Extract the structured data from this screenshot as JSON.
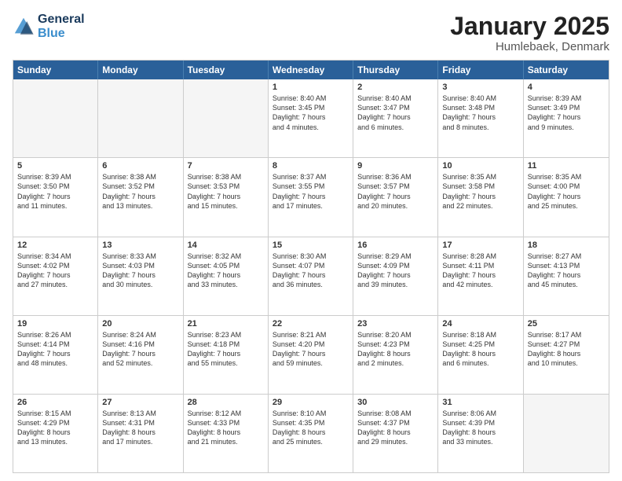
{
  "header": {
    "logo_general": "General",
    "logo_blue": "Blue",
    "month": "January 2025",
    "location": "Humlebaek, Denmark"
  },
  "weekdays": [
    "Sunday",
    "Monday",
    "Tuesday",
    "Wednesday",
    "Thursday",
    "Friday",
    "Saturday"
  ],
  "rows": [
    [
      {
        "day": "",
        "text": "",
        "shaded": true
      },
      {
        "day": "",
        "text": "",
        "shaded": true
      },
      {
        "day": "",
        "text": "",
        "shaded": true
      },
      {
        "day": "1",
        "text": "Sunrise: 8:40 AM\nSunset: 3:45 PM\nDaylight: 7 hours\nand 4 minutes."
      },
      {
        "day": "2",
        "text": "Sunrise: 8:40 AM\nSunset: 3:47 PM\nDaylight: 7 hours\nand 6 minutes."
      },
      {
        "day": "3",
        "text": "Sunrise: 8:40 AM\nSunset: 3:48 PM\nDaylight: 7 hours\nand 8 minutes."
      },
      {
        "day": "4",
        "text": "Sunrise: 8:39 AM\nSunset: 3:49 PM\nDaylight: 7 hours\nand 9 minutes."
      }
    ],
    [
      {
        "day": "5",
        "text": "Sunrise: 8:39 AM\nSunset: 3:50 PM\nDaylight: 7 hours\nand 11 minutes."
      },
      {
        "day": "6",
        "text": "Sunrise: 8:38 AM\nSunset: 3:52 PM\nDaylight: 7 hours\nand 13 minutes."
      },
      {
        "day": "7",
        "text": "Sunrise: 8:38 AM\nSunset: 3:53 PM\nDaylight: 7 hours\nand 15 minutes."
      },
      {
        "day": "8",
        "text": "Sunrise: 8:37 AM\nSunset: 3:55 PM\nDaylight: 7 hours\nand 17 minutes."
      },
      {
        "day": "9",
        "text": "Sunrise: 8:36 AM\nSunset: 3:57 PM\nDaylight: 7 hours\nand 20 minutes."
      },
      {
        "day": "10",
        "text": "Sunrise: 8:35 AM\nSunset: 3:58 PM\nDaylight: 7 hours\nand 22 minutes."
      },
      {
        "day": "11",
        "text": "Sunrise: 8:35 AM\nSunset: 4:00 PM\nDaylight: 7 hours\nand 25 minutes."
      }
    ],
    [
      {
        "day": "12",
        "text": "Sunrise: 8:34 AM\nSunset: 4:02 PM\nDaylight: 7 hours\nand 27 minutes."
      },
      {
        "day": "13",
        "text": "Sunrise: 8:33 AM\nSunset: 4:03 PM\nDaylight: 7 hours\nand 30 minutes."
      },
      {
        "day": "14",
        "text": "Sunrise: 8:32 AM\nSunset: 4:05 PM\nDaylight: 7 hours\nand 33 minutes."
      },
      {
        "day": "15",
        "text": "Sunrise: 8:30 AM\nSunset: 4:07 PM\nDaylight: 7 hours\nand 36 minutes."
      },
      {
        "day": "16",
        "text": "Sunrise: 8:29 AM\nSunset: 4:09 PM\nDaylight: 7 hours\nand 39 minutes."
      },
      {
        "day": "17",
        "text": "Sunrise: 8:28 AM\nSunset: 4:11 PM\nDaylight: 7 hours\nand 42 minutes."
      },
      {
        "day": "18",
        "text": "Sunrise: 8:27 AM\nSunset: 4:13 PM\nDaylight: 7 hours\nand 45 minutes."
      }
    ],
    [
      {
        "day": "19",
        "text": "Sunrise: 8:26 AM\nSunset: 4:14 PM\nDaylight: 7 hours\nand 48 minutes."
      },
      {
        "day": "20",
        "text": "Sunrise: 8:24 AM\nSunset: 4:16 PM\nDaylight: 7 hours\nand 52 minutes."
      },
      {
        "day": "21",
        "text": "Sunrise: 8:23 AM\nSunset: 4:18 PM\nDaylight: 7 hours\nand 55 minutes."
      },
      {
        "day": "22",
        "text": "Sunrise: 8:21 AM\nSunset: 4:20 PM\nDaylight: 7 hours\nand 59 minutes."
      },
      {
        "day": "23",
        "text": "Sunrise: 8:20 AM\nSunset: 4:23 PM\nDaylight: 8 hours\nand 2 minutes."
      },
      {
        "day": "24",
        "text": "Sunrise: 8:18 AM\nSunset: 4:25 PM\nDaylight: 8 hours\nand 6 minutes."
      },
      {
        "day": "25",
        "text": "Sunrise: 8:17 AM\nSunset: 4:27 PM\nDaylight: 8 hours\nand 10 minutes."
      }
    ],
    [
      {
        "day": "26",
        "text": "Sunrise: 8:15 AM\nSunset: 4:29 PM\nDaylight: 8 hours\nand 13 minutes."
      },
      {
        "day": "27",
        "text": "Sunrise: 8:13 AM\nSunset: 4:31 PM\nDaylight: 8 hours\nand 17 minutes."
      },
      {
        "day": "28",
        "text": "Sunrise: 8:12 AM\nSunset: 4:33 PM\nDaylight: 8 hours\nand 21 minutes."
      },
      {
        "day": "29",
        "text": "Sunrise: 8:10 AM\nSunset: 4:35 PM\nDaylight: 8 hours\nand 25 minutes."
      },
      {
        "day": "30",
        "text": "Sunrise: 8:08 AM\nSunset: 4:37 PM\nDaylight: 8 hours\nand 29 minutes."
      },
      {
        "day": "31",
        "text": "Sunrise: 8:06 AM\nSunset: 4:39 PM\nDaylight: 8 hours\nand 33 minutes."
      },
      {
        "day": "",
        "text": "",
        "shaded": true
      }
    ]
  ]
}
